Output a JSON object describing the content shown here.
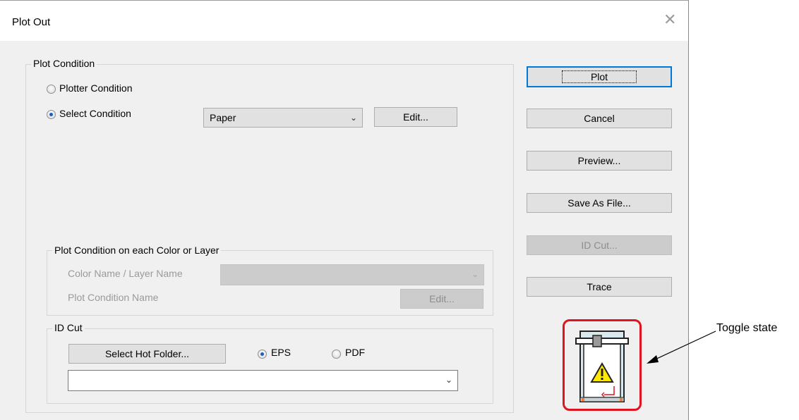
{
  "dialog": {
    "title": "Plot Out",
    "close_glyph": "✕"
  },
  "plot_condition": {
    "group_label": "Plot Condition",
    "plotter_condition_label": "Plotter Condition",
    "select_condition_label": "Select Condition",
    "selected_radio": "select_condition",
    "condition_combo_value": "Paper",
    "edit_button": "Edit..."
  },
  "color_layer": {
    "group_label": "Plot Condition on each Color or Layer",
    "color_layer_name_label": "Color Name / Layer Name",
    "color_layer_combo_value": "",
    "plot_condition_name_label": "Plot Condition Name",
    "edit_button": "Edit..."
  },
  "id_cut": {
    "group_label": "ID Cut",
    "select_hot_folder_button": "Select Hot Folder...",
    "eps_label": "EPS",
    "pdf_label": "PDF",
    "selected_format": "EPS",
    "folder_combo_value": ""
  },
  "side_buttons": {
    "plot": "Plot",
    "cancel": "Cancel",
    "preview": "Preview...",
    "save_as_file": "Save As File...",
    "id_cut": "ID Cut...",
    "trace": "Trace"
  },
  "toggle": {
    "icon": "plotter-warning-icon",
    "highlight_color": "#e0141e"
  },
  "callout": {
    "text": "Toggle state"
  }
}
